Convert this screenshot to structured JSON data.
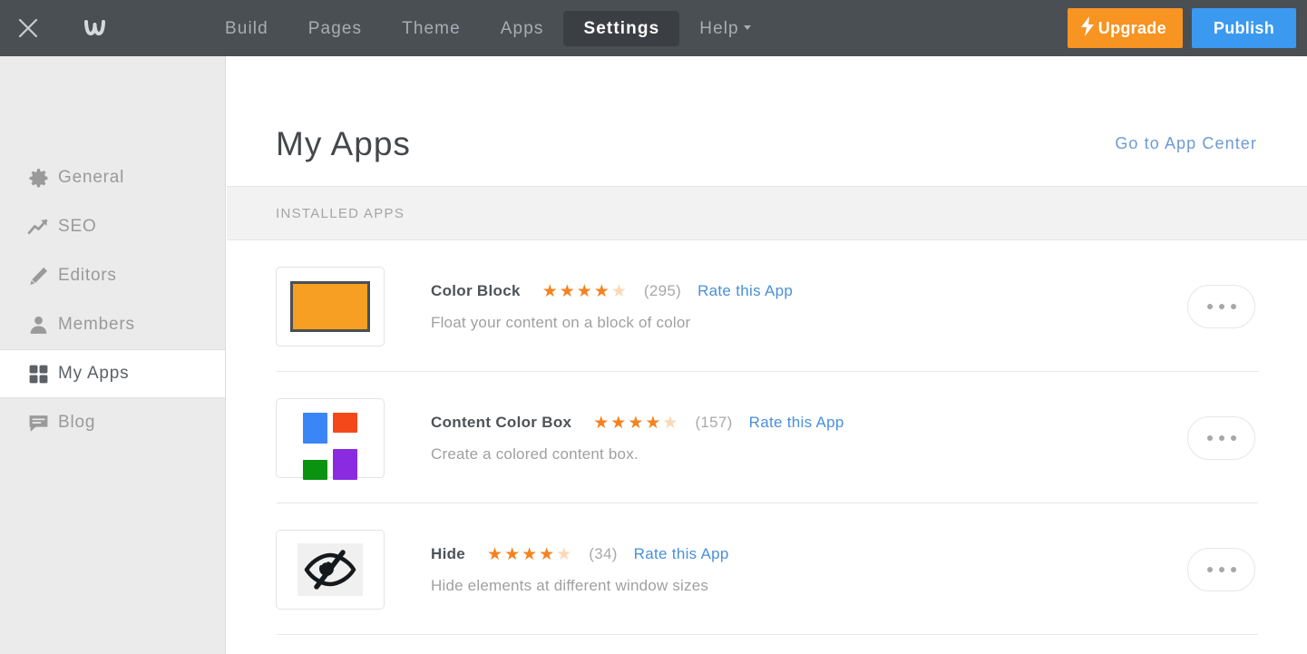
{
  "topnav": {
    "close_icon": "close-icon",
    "logo_icon": "weebly-logo-icon",
    "items": [
      {
        "label": "Build",
        "active": false,
        "caret": false
      },
      {
        "label": "Pages",
        "active": false,
        "caret": false
      },
      {
        "label": "Theme",
        "active": false,
        "caret": false
      },
      {
        "label": "Apps",
        "active": false,
        "caret": false
      },
      {
        "label": "Settings",
        "active": true,
        "caret": false
      },
      {
        "label": "Help",
        "active": false,
        "caret": true
      }
    ],
    "upgrade_label": "Upgrade",
    "upgrade_icon": "lightning-bolt-icon",
    "upgrade_color": "#f79422",
    "publish_label": "Publish",
    "publish_color": "#3b99f0",
    "bar_color": "#4a4f54"
  },
  "sidebar": {
    "items": [
      {
        "label": "General",
        "icon": "gear-icon",
        "active": false
      },
      {
        "label": "SEO",
        "icon": "trending-up-icon",
        "active": false
      },
      {
        "label": "Editors",
        "icon": "pencil-icon",
        "active": false
      },
      {
        "label": "Members",
        "icon": "person-icon",
        "active": false
      },
      {
        "label": "My Apps",
        "icon": "grid-icon",
        "active": true
      },
      {
        "label": "Blog",
        "icon": "chat-bubble-icon",
        "active": false
      }
    ]
  },
  "main": {
    "title": "My Apps",
    "app_center_link": "Go to App Center",
    "section_label": "INSTALLED APPS",
    "apps": [
      {
        "name": "Color Block",
        "description": "Float your content on a block of color",
        "stars_filled": 4,
        "stars_total": 5,
        "rating_count": "(295)",
        "rate_link": "Rate this App",
        "icon": "color-block-app-icon",
        "menu_icon": "more-options-icon"
      },
      {
        "name": "Content Color Box",
        "description": "Create a colored content box.",
        "stars_filled": 4,
        "stars_total": 5,
        "rating_count": "(157)",
        "rate_link": "Rate this App",
        "icon": "content-color-box-app-icon",
        "menu_icon": "more-options-icon"
      },
      {
        "name": "Hide",
        "description": "Hide elements at different window sizes",
        "stars_filled": 4,
        "stars_total": 5,
        "rating_count": "(34)",
        "rate_link": "Rate this App",
        "icon": "hide-app-icon",
        "menu_icon": "more-options-icon"
      }
    ]
  },
  "colors": {
    "star_filled": "#f58220",
    "star_empty": "#fbd9b6",
    "link_blue": "#4a90d9",
    "sidebar_bg": "#ebebeb"
  }
}
